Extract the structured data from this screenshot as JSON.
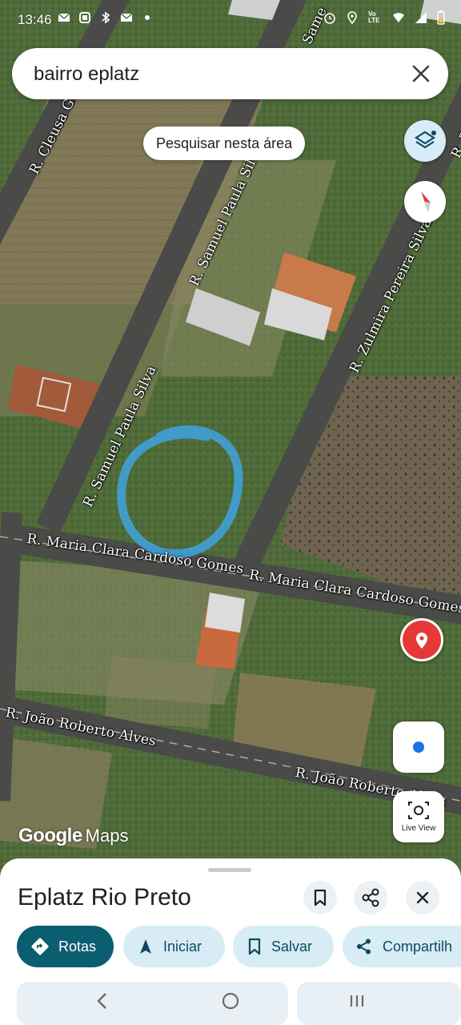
{
  "status_bar": {
    "time": "13:46",
    "left_icons": [
      "email-icon",
      "cast-icon",
      "bluetooth-icon",
      "email-icon",
      "dot-icon"
    ],
    "right_icons": [
      "alarm-icon",
      "location-icon",
      "volte-icon",
      "wifi-icon",
      "signal-icon",
      "battery-icon"
    ],
    "volte": "Vo LTE"
  },
  "search": {
    "query": "bairro eplatz"
  },
  "map": {
    "search_area_label": "Pesquisar nesta área",
    "live_view_label": "Live View",
    "logo_google": "Google",
    "logo_maps": "Maps",
    "street_labels": [
      "R. Cleusa G",
      "R. Samuel Paula Silva",
      "R. Samuel Paula Silva",
      "R. Zulmira Pereira Silva",
      "R. Maria Clara Cardoso Gomes",
      "R. Maria Clara Cardoso Gomes",
      "R. João Roberto Alves",
      "R. João Roberto Alves",
      "Same",
      "R. Zul"
    ],
    "annotation_color": "#3fa3e0",
    "pin_color": "#e53935"
  },
  "place": {
    "title": "Eplatz Rio Preto",
    "actions": {
      "directions": "Rotas",
      "start": "Iniciar",
      "save": "Salvar",
      "share": "Compartilh"
    }
  },
  "colors": {
    "primary": "#0b5d70",
    "chip_bg": "#d8ecf5",
    "chip_text": "#0b4a5e"
  }
}
